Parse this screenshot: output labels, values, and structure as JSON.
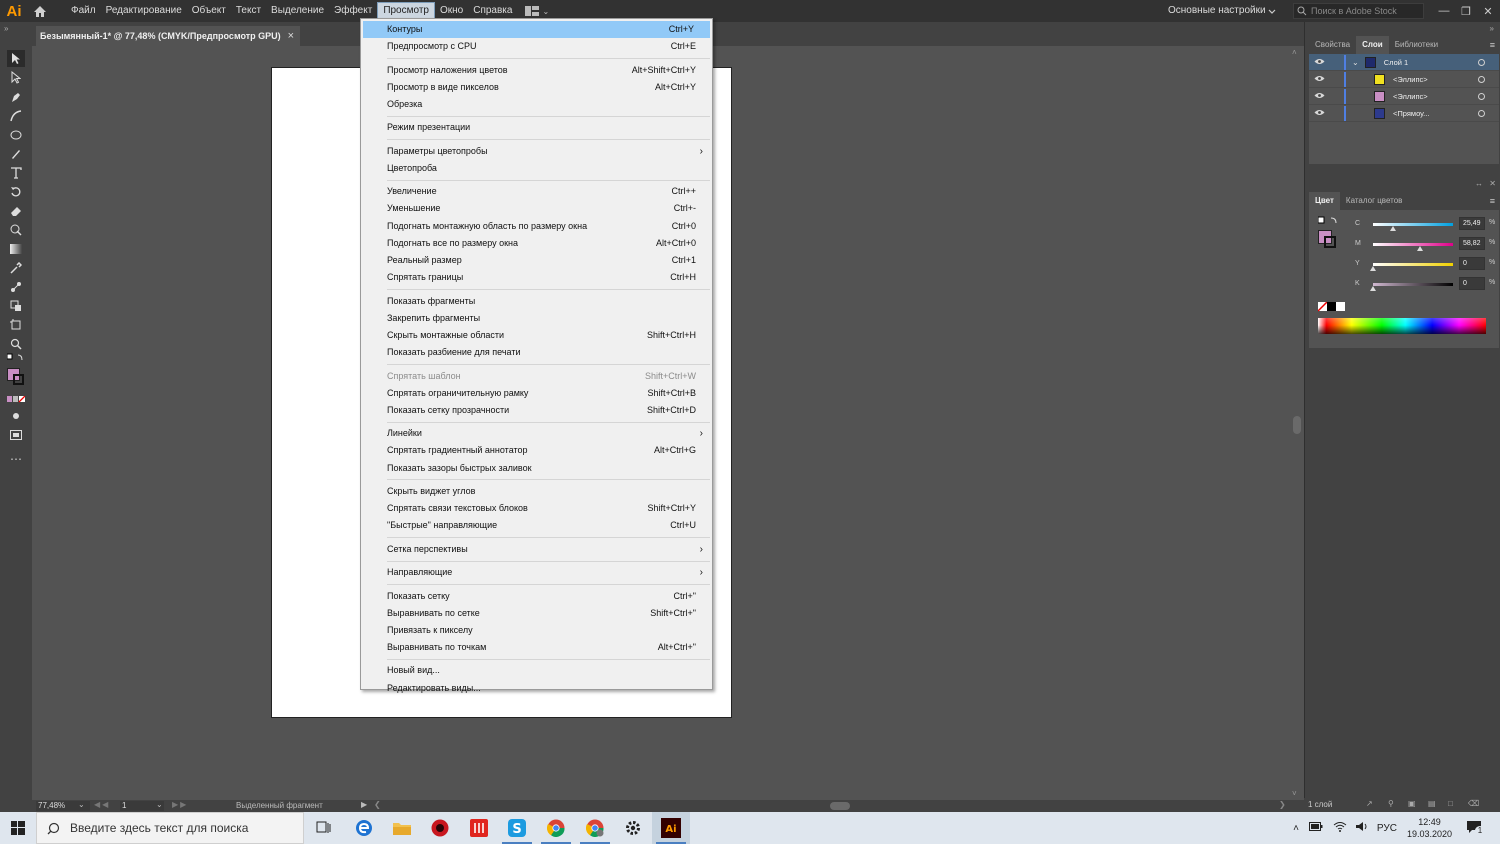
{
  "app": {
    "logo": "Ai",
    "workspace": "Основные настройки",
    "stock_search_placeholder": "Поиск в Adobe Stock"
  },
  "menubar": {
    "items": [
      "Файл",
      "Редактирование",
      "Объект",
      "Текст",
      "Выделение",
      "Эффект",
      "Просмотр",
      "Окно",
      "Справка"
    ],
    "active_index": 6
  },
  "document": {
    "tab_title": "Безымянный-1* @ 77,48% (CMYK/Предпросмотр GPU)",
    "close_glyph": "×"
  },
  "view_menu": [
    {
      "label": "Контуры",
      "shortcut": "Ctrl+Y",
      "highlight": true
    },
    {
      "label": "Предпросмотр с CPU",
      "shortcut": "Ctrl+E"
    },
    {
      "sep": true
    },
    {
      "label": "Просмотр наложения цветов",
      "shortcut": "Alt+Shift+Ctrl+Y"
    },
    {
      "label": "Просмотр в виде пикселов",
      "shortcut": "Alt+Ctrl+Y"
    },
    {
      "label": "Обрезка",
      "shortcut": ""
    },
    {
      "sep": true
    },
    {
      "label": "Режим презентации",
      "shortcut": ""
    },
    {
      "sep": true
    },
    {
      "label": "Параметры цветопробы",
      "shortcut": "",
      "submenu": true
    },
    {
      "label": "Цветопроба",
      "shortcut": ""
    },
    {
      "sep": true
    },
    {
      "label": "Увеличение",
      "shortcut": "Ctrl++"
    },
    {
      "label": "Уменьшение",
      "shortcut": "Ctrl+-"
    },
    {
      "label": "Подогнать монтажную область по размеру окна",
      "shortcut": "Ctrl+0"
    },
    {
      "label": "Подогнать все по размеру окна",
      "shortcut": "Alt+Ctrl+0"
    },
    {
      "label": "Реальный размер",
      "shortcut": "Ctrl+1"
    },
    {
      "label": "Спрятать границы",
      "shortcut": "Ctrl+H"
    },
    {
      "sep": true
    },
    {
      "label": "Показать фрагменты",
      "shortcut": ""
    },
    {
      "label": "Закрепить фрагменты",
      "shortcut": ""
    },
    {
      "label": "Скрыть монтажные области",
      "shortcut": "Shift+Ctrl+H"
    },
    {
      "label": "Показать разбиение для печати",
      "shortcut": ""
    },
    {
      "sep": true
    },
    {
      "label": "Спрятать шаблон",
      "shortcut": "Shift+Ctrl+W",
      "disabled": true
    },
    {
      "label": "Спрятать ограничительную рамку",
      "shortcut": "Shift+Ctrl+B"
    },
    {
      "label": "Показать сетку прозрачности",
      "shortcut": "Shift+Ctrl+D"
    },
    {
      "sep": true
    },
    {
      "label": "Линейки",
      "shortcut": "",
      "submenu": true
    },
    {
      "label": "Спрятать градиентный аннотатор",
      "shortcut": "Alt+Ctrl+G"
    },
    {
      "label": "Показать зазоры быстрых заливок",
      "shortcut": ""
    },
    {
      "sep": true
    },
    {
      "label": "Скрыть виджет углов",
      "shortcut": ""
    },
    {
      "label": "Спрятать связи текстовых блоков",
      "shortcut": "Shift+Ctrl+Y"
    },
    {
      "label": "\"Быстрые\" направляющие",
      "shortcut": "Ctrl+U"
    },
    {
      "sep": true
    },
    {
      "label": "Сетка перспективы",
      "shortcut": "",
      "submenu": true
    },
    {
      "sep": true
    },
    {
      "label": "Направляющие",
      "shortcut": "",
      "submenu": true
    },
    {
      "sep": true
    },
    {
      "label": "Показать сетку",
      "shortcut": "Ctrl+\""
    },
    {
      "label": "Выравнивать по сетке",
      "shortcut": "Shift+Ctrl+\""
    },
    {
      "label": "Привязать к пикселу",
      "shortcut": ""
    },
    {
      "label": "Выравнивать по точкам",
      "shortcut": "Alt+Ctrl+\""
    },
    {
      "sep": true
    },
    {
      "label": "Новый вид...",
      "shortcut": ""
    },
    {
      "label": "Редактировать виды...",
      "shortcut": ""
    }
  ],
  "panels": {
    "top_tabs": [
      "Свойства",
      "Слои",
      "Библиотеки"
    ],
    "top_active": 1,
    "layers": [
      {
        "name": "Слой 1",
        "color": "#1f2a6b",
        "top": true
      },
      {
        "name": "<Эллипс>",
        "color": "#f0e020"
      },
      {
        "name": "<Эллипс>",
        "color": "#c98fc4"
      },
      {
        "name": "<Прямоу...",
        "color": "#2d3a8c"
      }
    ],
    "layers_footer": "1 слой",
    "color_tabs": [
      "Цвет",
      "Каталог цветов"
    ],
    "color_active": 0,
    "fill_color": "#c98fc4",
    "cmyk": [
      {
        "label": "C",
        "value": "25,49",
        "fraction": 0.2549,
        "from": "#ffffff",
        "to": "#00a0e0"
      },
      {
        "label": "M",
        "value": "58,82",
        "fraction": 0.5882,
        "from": "#ffffff",
        "to": "#e0008a"
      },
      {
        "label": "Y",
        "value": "0",
        "fraction": 0,
        "from": "#ffffff",
        "to": "#f0d000"
      },
      {
        "label": "K",
        "value": "0",
        "fraction": 0,
        "from": "#d0b8d0",
        "to": "#000000"
      }
    ],
    "percent": "%"
  },
  "status": {
    "zoom": "77,48%",
    "artboard": "1",
    "selection_text": "Выделенный фрагмент"
  },
  "taskbar": {
    "search_placeholder": "Введите здесь текст для поиска",
    "language": "РУС",
    "time": "12:49",
    "date": "19.03.2020",
    "notifications": "1"
  }
}
